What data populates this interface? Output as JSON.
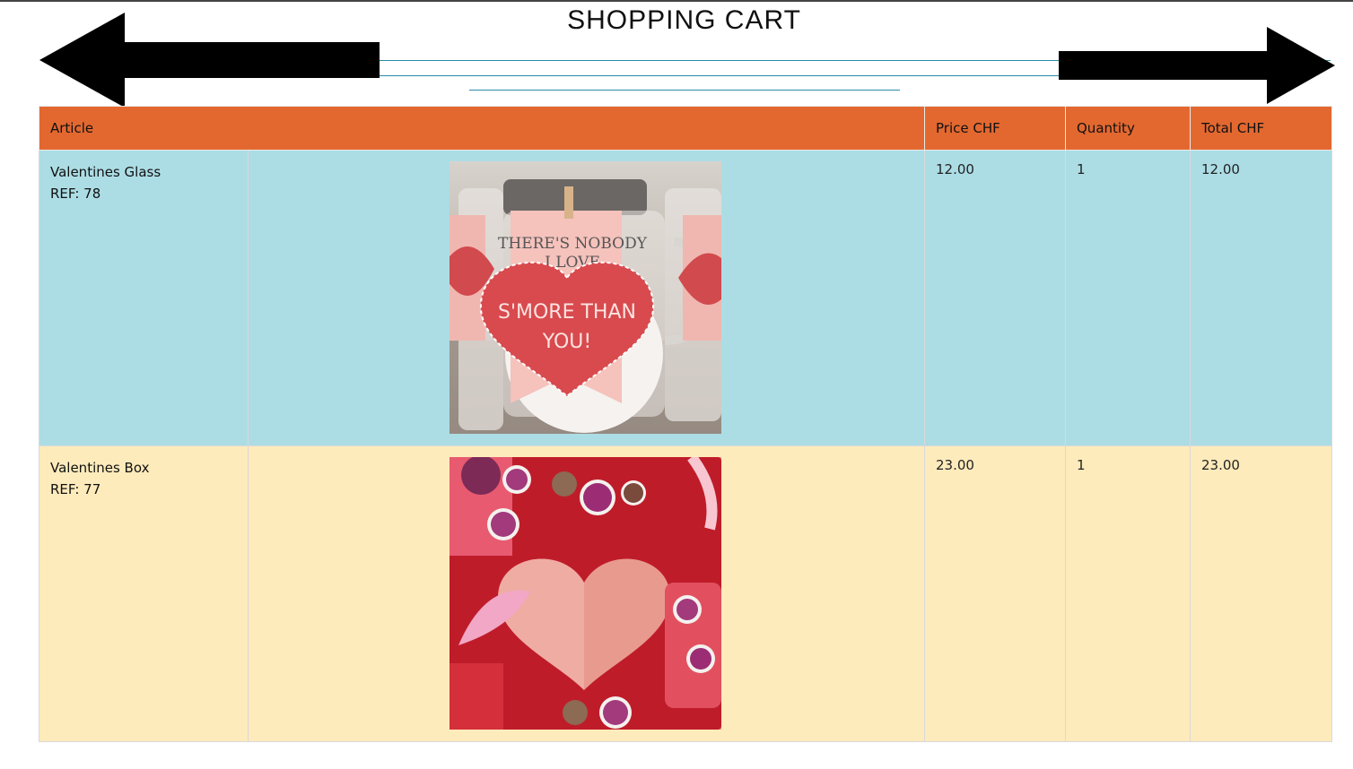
{
  "page": {
    "title": "SHOPPING CART"
  },
  "nav": {
    "prev_icon": "arrow-left-icon",
    "next_icon": "arrow-right-icon"
  },
  "table": {
    "headers": {
      "article": "Article",
      "price": "Price CHF",
      "quantity": "Quantity",
      "total": "Total CHF"
    },
    "rows": [
      {
        "name": "Valentines Glass",
        "ref": "REF: 78",
        "price": "12.00",
        "quantity": "1",
        "total": "12.00",
        "image_tag_line1": "THERE'S NOBODY",
        "image_tag_line2": "I LOVE",
        "image_heart_line1": "S'MORE THAN",
        "image_heart_line2": "YOU!"
      },
      {
        "name": "Valentines Box",
        "ref": "REF: 77",
        "price": "23.00",
        "quantity": "1",
        "total": "23.00"
      }
    ]
  },
  "colors": {
    "header": "#e36830",
    "row1": "#acdde5",
    "row2": "#feebbb"
  }
}
